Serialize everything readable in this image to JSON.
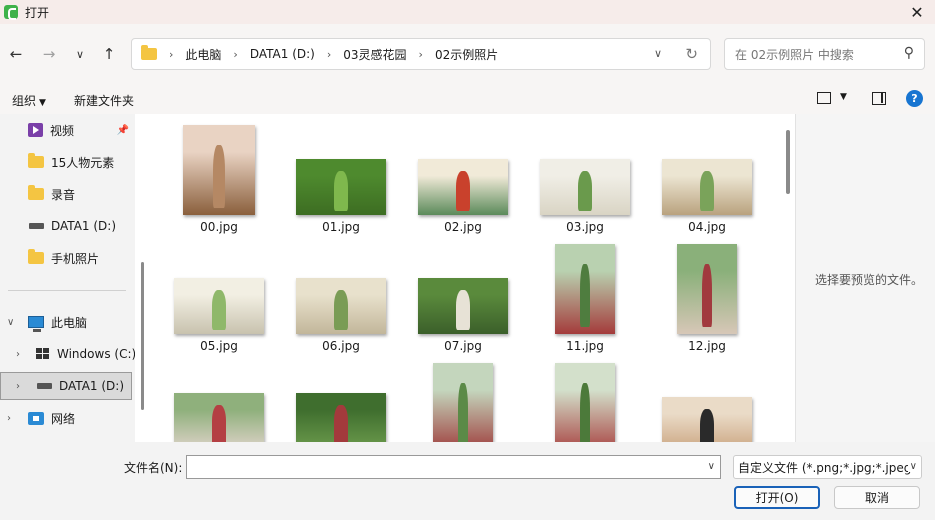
{
  "titlebar": {
    "title": "打开",
    "close_glyph": "✕"
  },
  "nav": {
    "back_icon": "arrow-left-icon",
    "forward_icon": "arrow-right-icon",
    "recent_icon": "chevron-down-icon",
    "up_icon": "arrow-up-icon",
    "breadcrumb": [
      "此电脑",
      "DATA1 (D:)",
      "03灵感花园",
      "02示例照片"
    ],
    "search_placeholder": "在 02示例照片 中搜索"
  },
  "toolbar": {
    "organize": "组织",
    "new_folder": "新建文件夹"
  },
  "sidebar": {
    "items": [
      {
        "label": "视频",
        "icon": "video-icon",
        "pinned": true
      },
      {
        "label": "15人物元素",
        "icon": "folder-icon"
      },
      {
        "label": "录音",
        "icon": "folder-icon"
      },
      {
        "label": "DATA1 (D:)",
        "icon": "drive-icon"
      },
      {
        "label": "手机照片",
        "icon": "folder-icon"
      },
      {
        "label": "此电脑",
        "icon": "pc-icon",
        "expanded": true
      },
      {
        "label": "Windows (C:)",
        "icon": "windows-drive-icon"
      },
      {
        "label": "DATA1 (D:)",
        "icon": "drive-icon",
        "selected": true
      },
      {
        "label": "网络",
        "icon": "network-icon"
      }
    ]
  },
  "files": [
    {
      "name": "00.jpg",
      "colors": [
        "#e9d3c3",
        "#b58864",
        "#8a5f3c"
      ]
    },
    {
      "name": "01.jpg",
      "colors": [
        "#4e8a2e",
        "#7fb84d",
        "#3d6d22"
      ]
    },
    {
      "name": "02.jpg",
      "colors": [
        "#f1ead8",
        "#c9412c",
        "#5b8a5a"
      ]
    },
    {
      "name": "03.jpg",
      "colors": [
        "#f0eee6",
        "#6a9a4c",
        "#d9d4c4"
      ]
    },
    {
      "name": "04.jpg",
      "colors": [
        "#ece5d2",
        "#7aa35a",
        "#b9a27e"
      ]
    },
    {
      "name": "05.jpg",
      "colors": [
        "#f2efe3",
        "#8fb86a",
        "#c8c2ae"
      ]
    },
    {
      "name": "06.jpg",
      "colors": [
        "#e8e1cc",
        "#7a9c55",
        "#c2b69a"
      ]
    },
    {
      "name": "07.jpg",
      "colors": [
        "#5a8a3c",
        "#e7e2d6",
        "#3b5f2a"
      ]
    },
    {
      "name": "11.jpg",
      "colors": [
        "#b9d1b0",
        "#4f7d3f",
        "#a43b3b"
      ]
    },
    {
      "name": "12.jpg",
      "colors": [
        "#8ab07a",
        "#a13a3e",
        "#d7c7b7"
      ]
    },
    {
      "name": "",
      "colors": [
        "#8fb07c",
        "#b43f43",
        "#dcd2c7"
      ]
    },
    {
      "name": "",
      "colors": [
        "#3f6e2e",
        "#a33a3c",
        "#6b9a4c"
      ]
    },
    {
      "name": "",
      "colors": [
        "#c4d6bd",
        "#5b8a47",
        "#9e3a3a"
      ]
    },
    {
      "name": "",
      "colors": [
        "#d3e0cb",
        "#4c7a3a",
        "#a8403f"
      ]
    },
    {
      "name": "",
      "colors": [
        "#eadbc7",
        "#2a2a2a",
        "#c9a27d"
      ]
    }
  ],
  "preview": {
    "empty_text": "选择要预览的文件。"
  },
  "bottom": {
    "filename_label": "文件名(N):",
    "filename_value": "",
    "filetype": "自定义文件 (*.png;*.jpg;*.jpeg",
    "open": "打开(O)",
    "cancel": "取消"
  }
}
